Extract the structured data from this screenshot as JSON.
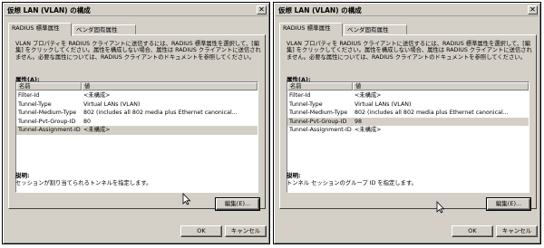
{
  "dialogs": [
    {
      "title": "仮想 LAN (VLAN) の構成",
      "close_glyph": "✕",
      "tabs": [
        "RADIUS 標準属性",
        "ベンダ固有属性"
      ],
      "description": "VLAN プロパティを RADIUS クライアントに送信するには、RADIUS 標準属性を選択して、[編集] をクリックしてください。属性を構成しない場合、属性は RADIUS クライアントに送信されません。必要な属性については、RADIUS クライアントのドキュメントを参照してください。",
      "attributes_label": "属性(A):",
      "columns": [
        "名前",
        "値"
      ],
      "rows": [
        {
          "name": "Filter-Id",
          "value": "<未構成>"
        },
        {
          "name": "Tunnel-Type",
          "value": "Virtual LANs (VLAN)"
        },
        {
          "name": "Tunnel-Medium-Type",
          "value": "802 (includes all 802 media plus Ethernet canonical..."
        },
        {
          "name": "Tunnel-Pvt-Group-ID",
          "value": "80"
        },
        {
          "name": "Tunnel-Assignment-ID",
          "value": "<未構成>"
        }
      ],
      "selected_row": 4,
      "explanation_label": "説明:",
      "explanation_text": "セッションが割り当てられるトンネルを指定します。",
      "edit_button": "編集(E)...",
      "ok_button": "OK",
      "cancel_button": "キャンセル"
    },
    {
      "title": "仮想 LAN (VLAN) の構成",
      "close_glyph": "✕",
      "tabs": [
        "RADIUS 標準属性",
        "ベンダ固有属性"
      ],
      "description": "VLAN プロパティを RADIUS クライアントに送信するには、RADIUS 標準属性を選択して、[編集] をクリックしてください。属性を構成しない場合、属性は RADIUS クライアントに送信されません。必要な属性については、RADIUS クライアントのドキュメントを参照してください。",
      "attributes_label": "属性(A):",
      "columns": [
        "名前",
        "値"
      ],
      "rows": [
        {
          "name": "Filter-Id",
          "value": "<未構成>"
        },
        {
          "name": "Tunnel-Type",
          "value": "Virtual LANs (VLAN)"
        },
        {
          "name": "Tunnel-Medium-Type",
          "value": "802 (includes all 802 media plus Ethernet canonical..."
        },
        {
          "name": "Tunnel-Pvt-Group-ID",
          "value": "98"
        },
        {
          "name": "Tunnel-Assignment-ID",
          "value": "<未構成>"
        }
      ],
      "selected_row": 3,
      "explanation_label": "説明:",
      "explanation_text": "トンネル セッションのグループ ID を指定します。",
      "edit_button": "編集(E)...",
      "ok_button": "OK",
      "cancel_button": "キャンセル"
    }
  ]
}
